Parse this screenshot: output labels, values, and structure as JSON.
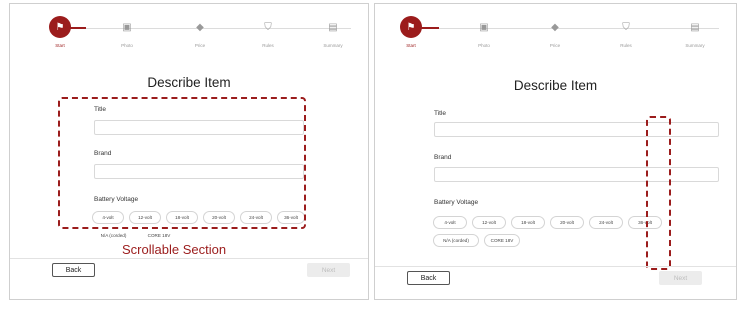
{
  "colors": {
    "accent": "#9b1c1c",
    "border": "#cfcfcf",
    "disabled": "#bdbdbd"
  },
  "steps": [
    {
      "label": "Start",
      "icon": "flag-icon",
      "active": true
    },
    {
      "label": "Photo",
      "icon": "photo-icon",
      "active": false
    },
    {
      "label": "Price",
      "icon": "tag-icon",
      "active": false
    },
    {
      "label": "Rules",
      "icon": "shield-icon",
      "active": false
    },
    {
      "label": "Summary",
      "icon": "document-icon",
      "active": false
    }
  ],
  "form": {
    "heading": "Describe Item",
    "title_label": "Title",
    "title_value": "",
    "brand_label": "Brand",
    "brand_value": "",
    "voltage_label": "Battery Voltage",
    "voltage_options": [
      "4-volt",
      "12-volt",
      "18-volt",
      "20-volt",
      "24-volt",
      "36-volt",
      "N/A (corded)",
      "CORE 18V"
    ]
  },
  "footer": {
    "back_label": "Back",
    "next_label": "Next"
  },
  "annotation": {
    "label": "Scrollable Section"
  }
}
